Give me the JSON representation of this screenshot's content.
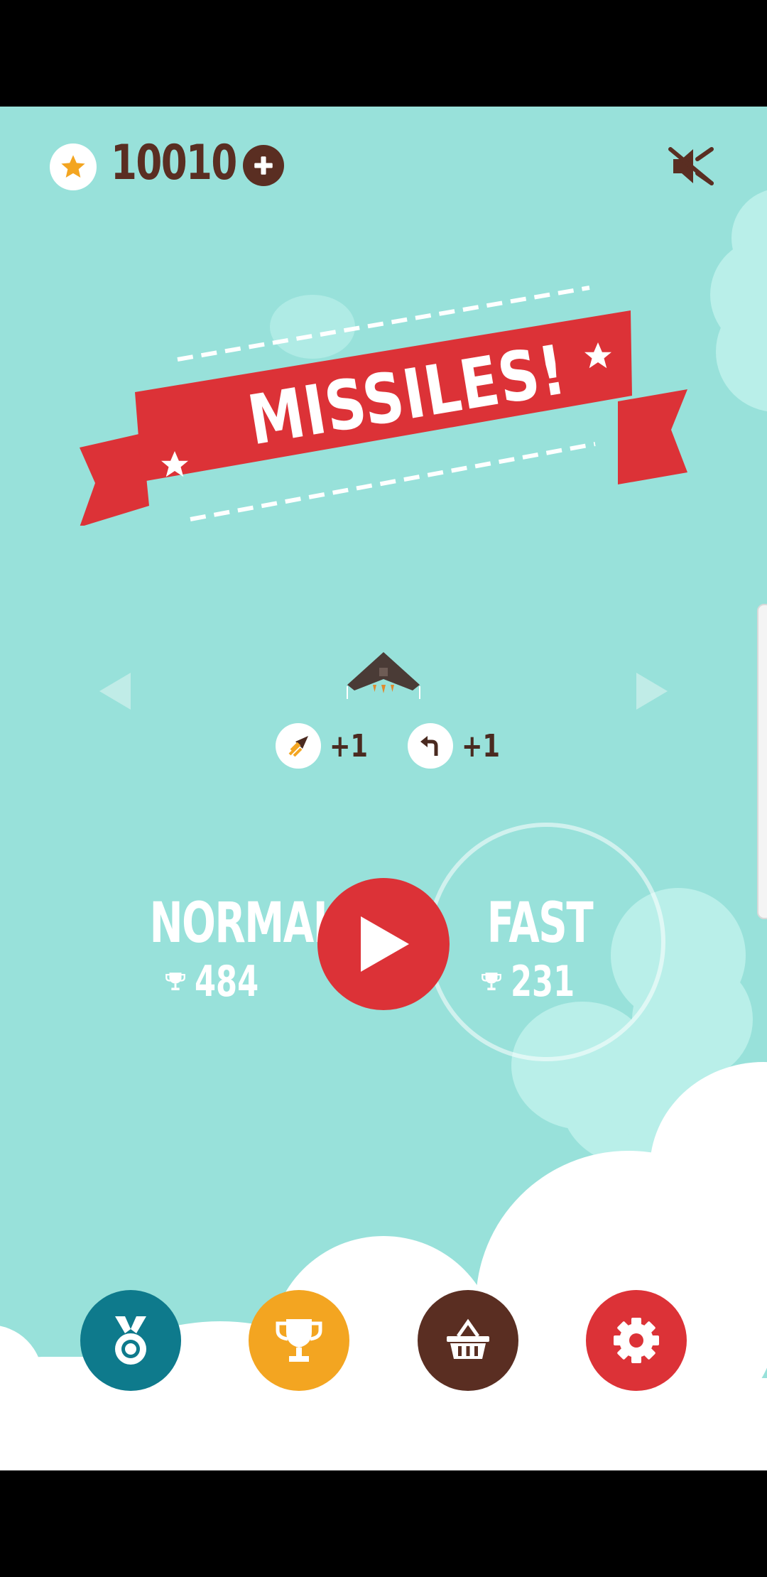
{
  "topbar": {
    "coins": "10010",
    "coin_icon": "star-icon",
    "add_icon": "plus-icon",
    "sound_icon": "speaker-muted-icon"
  },
  "banner": {
    "title": "MISSILES!"
  },
  "selector": {
    "prev_icon": "triangle-left-icon",
    "next_icon": "triangle-right-icon",
    "aircraft_icon": "stealth-bomber-icon",
    "powers": [
      {
        "icon": "missile-icon",
        "label": "+1"
      },
      {
        "icon": "turn-arrow-icon",
        "label": "+1"
      }
    ]
  },
  "modes": {
    "normal": {
      "label": "NORMAL",
      "best": "484"
    },
    "fast": {
      "label": "FAST",
      "best": "231"
    },
    "play_icon": "play-icon"
  },
  "bottom_nav": [
    {
      "icon": "medal-icon",
      "color": "#0e7a8c"
    },
    {
      "icon": "trophy-icon",
      "color": "#f3a521"
    },
    {
      "icon": "basket-icon",
      "color": "#5a2e22"
    },
    {
      "icon": "gear-icon",
      "color": "#dc3237"
    }
  ],
  "colors": {
    "sky": "#98e1da",
    "brown": "#5a2e22",
    "red": "#dc3237",
    "gold": "#f3a521",
    "teal": "#0e7a8c"
  }
}
